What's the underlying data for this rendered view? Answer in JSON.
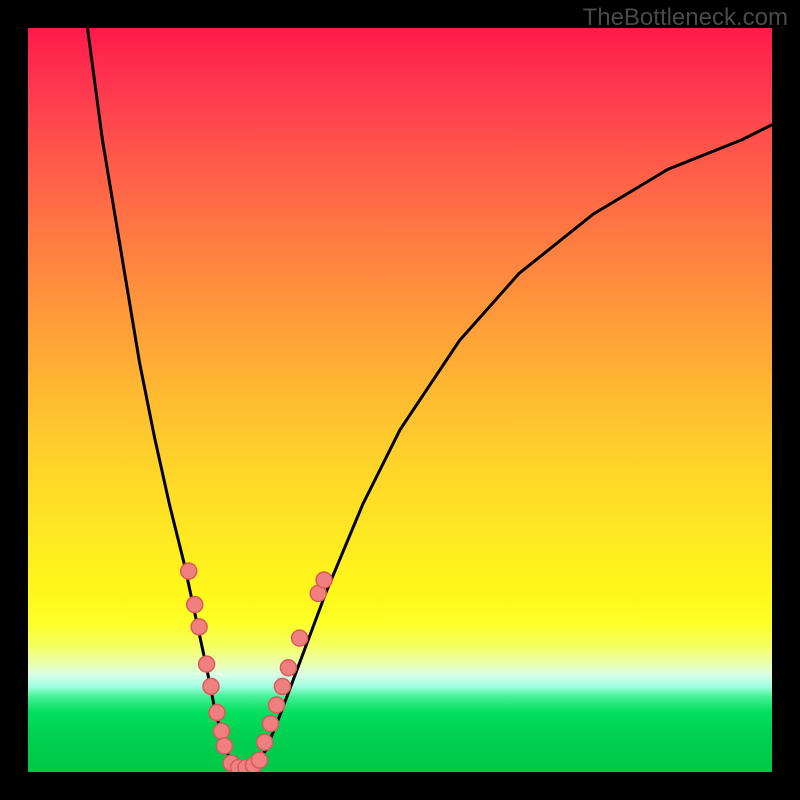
{
  "watermark": "TheBottleneck.com",
  "colors": {
    "gradient_top": "#ff1a4a",
    "gradient_mid": "#ffe822",
    "gradient_bottom": "#00c848",
    "curve": "#000000",
    "dot_fill": "#f08080",
    "dot_stroke": "#d85a5a",
    "background": "#000000"
  },
  "chart_data": {
    "type": "line",
    "title": "",
    "xlabel": "",
    "ylabel": "",
    "xlim": [
      0,
      100
    ],
    "ylim": [
      0,
      100
    ],
    "grid": false,
    "note": "Bottleneck-style V-curve on a rainbow heat background. Values are percentage coordinates (0–100) inferred from the image. Left curve descends steeply from top-left to the trough; right curve rises from the trough asymptotically toward the right edge. Pink dots mark sampled points on both flanks and along the flat trough.",
    "series": [
      {
        "name": "left_curve",
        "x": [
          8,
          10,
          13,
          15,
          17,
          19,
          21,
          22.5,
          24,
          25,
          26,
          27,
          28
        ],
        "y": [
          100,
          85,
          67,
          55,
          45,
          36,
          28,
          21,
          14,
          9,
          5,
          2,
          0
        ]
      },
      {
        "name": "right_curve",
        "x": [
          30,
          32,
          34,
          37,
          40,
          45,
          50,
          58,
          66,
          76,
          86,
          96,
          100
        ],
        "y": [
          0,
          3,
          8,
          16,
          24,
          36,
          46,
          58,
          67,
          75,
          81,
          85,
          87
        ]
      }
    ],
    "dots_left": [
      {
        "x": 21.6,
        "y": 27.0
      },
      {
        "x": 22.4,
        "y": 22.5
      },
      {
        "x": 23.0,
        "y": 19.5
      },
      {
        "x": 24.0,
        "y": 14.5
      },
      {
        "x": 24.6,
        "y": 11.5
      },
      {
        "x": 25.4,
        "y": 8.0
      },
      {
        "x": 26.0,
        "y": 5.5
      },
      {
        "x": 26.4,
        "y": 3.5
      }
    ],
    "dots_right": [
      {
        "x": 31.8,
        "y": 4.0
      },
      {
        "x": 32.6,
        "y": 6.5
      },
      {
        "x": 33.4,
        "y": 9.0
      },
      {
        "x": 34.2,
        "y": 11.5
      },
      {
        "x": 35.0,
        "y": 14.0
      },
      {
        "x": 36.5,
        "y": 18.0
      },
      {
        "x": 39.0,
        "y": 24.0
      },
      {
        "x": 39.8,
        "y": 25.8
      }
    ],
    "dots_bottom": [
      {
        "x": 27.3,
        "y": 1.2
      },
      {
        "x": 28.3,
        "y": 0.6
      },
      {
        "x": 29.3,
        "y": 0.6
      },
      {
        "x": 30.3,
        "y": 0.9
      },
      {
        "x": 31.1,
        "y": 1.6
      }
    ]
  }
}
